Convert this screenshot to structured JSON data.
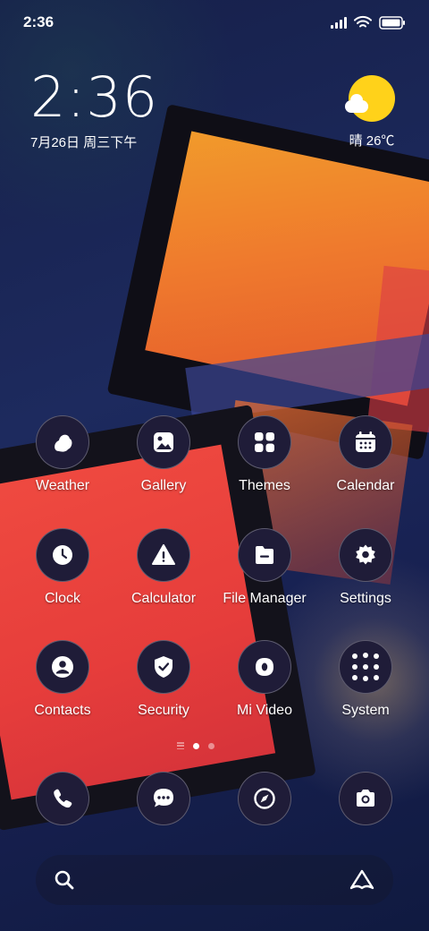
{
  "status_bar": {
    "time": "2:36",
    "icons": [
      "signal-icon",
      "wifi-icon",
      "battery-icon"
    ]
  },
  "clock_widget": {
    "time": "2:36",
    "date": "7月26日 周三下午"
  },
  "weather_widget": {
    "icon": "sunny-cloud-icon",
    "text": "晴 26℃"
  },
  "apps": [
    {
      "label": "Weather",
      "icon": "weather-icon"
    },
    {
      "label": "Gallery",
      "icon": "gallery-icon"
    },
    {
      "label": "Themes",
      "icon": "themes-icon"
    },
    {
      "label": "Calendar",
      "icon": "calendar-icon"
    },
    {
      "label": "Clock",
      "icon": "clock-icon"
    },
    {
      "label": "Calculator",
      "icon": "calculator-icon"
    },
    {
      "label": "File Manager",
      "icon": "file-manager-icon"
    },
    {
      "label": "Settings",
      "icon": "settings-icon"
    },
    {
      "label": "Contacts",
      "icon": "contacts-icon"
    },
    {
      "label": "Security",
      "icon": "security-icon"
    },
    {
      "label": "Mi Video",
      "icon": "mi-video-icon"
    },
    {
      "label": "System",
      "icon": "system-folder-icon"
    }
  ],
  "page_indicator": {
    "pages": 2,
    "current": 1
  },
  "dock": [
    {
      "icon": "phone-icon"
    },
    {
      "icon": "messages-icon"
    },
    {
      "icon": "browser-icon"
    },
    {
      "icon": "camera-icon"
    }
  ],
  "search_bar": {
    "left_icon": "search-icon",
    "right_icon": "assistant-icon"
  },
  "colors": {
    "icon_bg": "#1f1c38",
    "sun": "#ffd21a",
    "wallpaper_red": "#e63d3b",
    "wallpaper_orange": "#f19a2b"
  }
}
